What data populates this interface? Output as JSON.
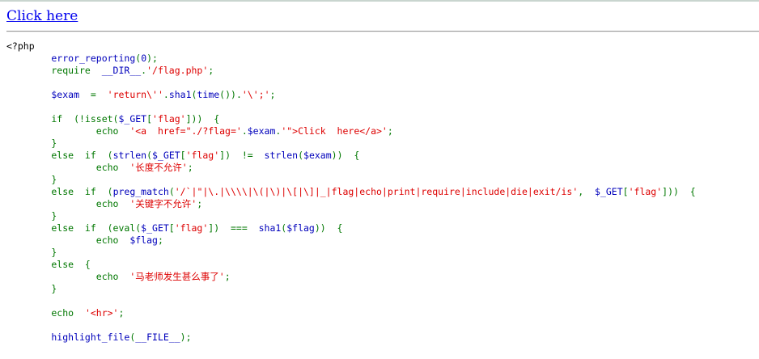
{
  "link": {
    "label": "Click here"
  },
  "colors": {
    "default": "#0000bb",
    "keyword": "#007700",
    "string": "#dd0000",
    "html": "#000000",
    "link": "#0000ee"
  },
  "code_lines": [
    [
      [
        "html",
        "<?php"
      ]
    ],
    [
      [
        "default",
        "        error_reporting"
      ],
      [
        "keyword",
        "("
      ],
      [
        "default",
        "0"
      ],
      [
        "keyword",
        ");"
      ]
    ],
    [
      [
        "keyword",
        "        require  "
      ],
      [
        "default",
        "__DIR__"
      ],
      [
        "keyword",
        "."
      ],
      [
        "string",
        "'/flag.php'"
      ],
      [
        "keyword",
        ";"
      ]
    ],
    [],
    [
      [
        "default",
        "        $exam  "
      ],
      [
        "keyword",
        "=  "
      ],
      [
        "string",
        "'return\\''"
      ],
      [
        "keyword",
        "."
      ],
      [
        "default",
        "sha1"
      ],
      [
        "keyword",
        "("
      ],
      [
        "default",
        "time"
      ],
      [
        "keyword",
        "())."
      ],
      [
        "string",
        "'\\';'"
      ],
      [
        "keyword",
        ";"
      ]
    ],
    [],
    [
      [
        "keyword",
        "        if  (!isset("
      ],
      [
        "default",
        "$_GET"
      ],
      [
        "keyword",
        "["
      ],
      [
        "string",
        "'flag'"
      ],
      [
        "keyword",
        "]))  {"
      ]
    ],
    [
      [
        "keyword",
        "                echo  "
      ],
      [
        "string",
        "'<a  href=\"./?flag='"
      ],
      [
        "keyword",
        "."
      ],
      [
        "default",
        "$exam"
      ],
      [
        "keyword",
        "."
      ],
      [
        "string",
        "'\">Click  here</a>'"
      ],
      [
        "keyword",
        ";"
      ]
    ],
    [
      [
        "keyword",
        "        }"
      ]
    ],
    [
      [
        "keyword",
        "        else  if  ("
      ],
      [
        "default",
        "strlen"
      ],
      [
        "keyword",
        "("
      ],
      [
        "default",
        "$_GET"
      ],
      [
        "keyword",
        "["
      ],
      [
        "string",
        "'flag'"
      ],
      [
        "keyword",
        "])  !=  "
      ],
      [
        "default",
        "strlen"
      ],
      [
        "keyword",
        "("
      ],
      [
        "default",
        "$exam"
      ],
      [
        "keyword",
        "))  {"
      ]
    ],
    [
      [
        "keyword",
        "                echo  "
      ],
      [
        "string",
        "'长度不允许'"
      ],
      [
        "keyword",
        ";"
      ]
    ],
    [
      [
        "keyword",
        "        }"
      ]
    ],
    [
      [
        "keyword",
        "        else  if  ("
      ],
      [
        "default",
        "preg_match"
      ],
      [
        "keyword",
        "("
      ],
      [
        "string",
        "'/`|\"|\\.|\\\\\\\\|\\(|\\)|\\[|\\]|_|flag|echo|print|require|include|die|exit/is'"
      ],
      [
        "keyword",
        ",  "
      ],
      [
        "default",
        "$_GET"
      ],
      [
        "keyword",
        "["
      ],
      [
        "string",
        "'flag'"
      ],
      [
        "keyword",
        "]))  {"
      ]
    ],
    [
      [
        "keyword",
        "                echo  "
      ],
      [
        "string",
        "'关键字不允许'"
      ],
      [
        "keyword",
        ";"
      ]
    ],
    [
      [
        "keyword",
        "        }"
      ]
    ],
    [
      [
        "keyword",
        "        else  if  (eval("
      ],
      [
        "default",
        "$_GET"
      ],
      [
        "keyword",
        "["
      ],
      [
        "string",
        "'flag'"
      ],
      [
        "keyword",
        "])  ===  "
      ],
      [
        "default",
        "sha1"
      ],
      [
        "keyword",
        "("
      ],
      [
        "default",
        "$flag"
      ],
      [
        "keyword",
        "))  {"
      ]
    ],
    [
      [
        "keyword",
        "                echo  "
      ],
      [
        "default",
        "$flag"
      ],
      [
        "keyword",
        ";"
      ]
    ],
    [
      [
        "keyword",
        "        }"
      ]
    ],
    [
      [
        "keyword",
        "        else  {"
      ]
    ],
    [
      [
        "keyword",
        "                echo  "
      ],
      [
        "string",
        "'马老师发生甚么事了'"
      ],
      [
        "keyword",
        ";"
      ]
    ],
    [
      [
        "keyword",
        "        }"
      ]
    ],
    [],
    [
      [
        "keyword",
        "        echo  "
      ],
      [
        "string",
        "'<hr>'"
      ],
      [
        "keyword",
        ";"
      ]
    ],
    [],
    [
      [
        "default",
        "        highlight_file"
      ],
      [
        "keyword",
        "("
      ],
      [
        "default",
        "__FILE__"
      ],
      [
        "keyword",
        ");"
      ]
    ]
  ]
}
